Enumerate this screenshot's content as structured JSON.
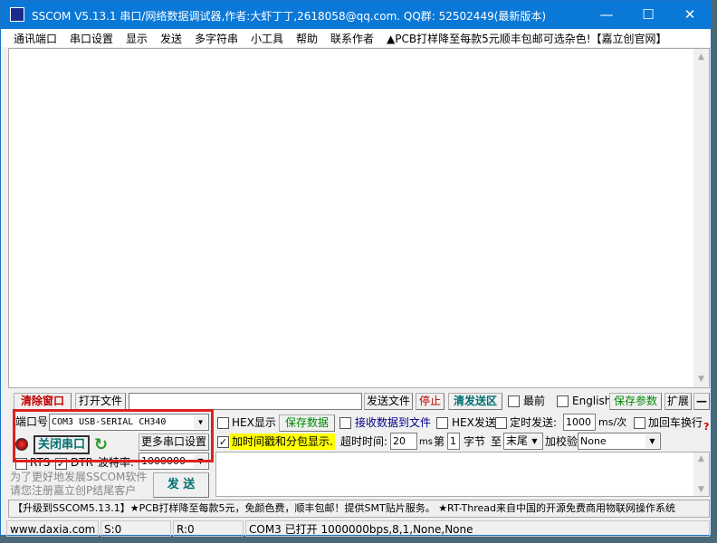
{
  "title": "SSCOM V5.13.1 串口/网络数据调试器,作者:大虾丁丁,2618058@qq.com. QQ群: 52502449(最新版本)",
  "menu": [
    "通讯端口",
    "串口设置",
    "显示",
    "发送",
    "多字符串",
    "小工具",
    "帮助",
    "联系作者",
    "▲PCB打样降至每款5元顺丰包邮可选杂色!【嘉立创官网】"
  ],
  "toolbar": {
    "clear": "清除窗口",
    "open_file": "打开文件",
    "file_path": "",
    "send_file": "发送文件",
    "stop": "停止",
    "clear_send": "清发送区",
    "topmost": "最前",
    "english": "English",
    "save_params": "保存参数",
    "expand": "扩展",
    "collapse": "—"
  },
  "port": {
    "label": "端口号",
    "value": "COM3 USB-SERIAL CH340",
    "close": "关闭串口",
    "more": "更多串口设置",
    "rts": "RTS",
    "dtr": "DTR",
    "baud_label": "波特率:",
    "baud": "1000000"
  },
  "options": {
    "hex_show": "HEX显示",
    "save_data": "保存数据",
    "recv_to_file": "接收数据到文件",
    "hex_send": "HEX发送",
    "timed_send": "定时发送:",
    "interval": "1000",
    "interval_unit": "ms/次",
    "add_crlf": "加回车换行",
    "timestamp": "加时间戳和分包显示.",
    "timeout_label": "超时时间:",
    "timeout": "20",
    "timeout_unit": "ms",
    "byte_from_label": "第",
    "byte_from": "1",
    "byte_unit": "字节",
    "to_label": "至",
    "to_value": "末尾",
    "checksum_label": "加校验",
    "checksum": "None"
  },
  "promo": {
    "line1": "为了更好地发展SSCOM软件",
    "line2": "请您注册嘉立创P结尾客户",
    "send": "发  送"
  },
  "ticker": "【升级到SSCOM5.13.1】★PCB打样降至每款5元，免颜色费，顺丰包邮！提供SMT贴片服务。 ★RT-Thread来自中国的开源免费商用物联网操作系统",
  "status": {
    "site": "www.daxia.com",
    "s": "S:0",
    "r": "R:0",
    "port": "COM3 已打开  1000000bps,8,1,None,None"
  },
  "colors": {
    "titlebar": "#0a78d7",
    "highlight": "#ffff00",
    "red_box": "#e02020"
  }
}
